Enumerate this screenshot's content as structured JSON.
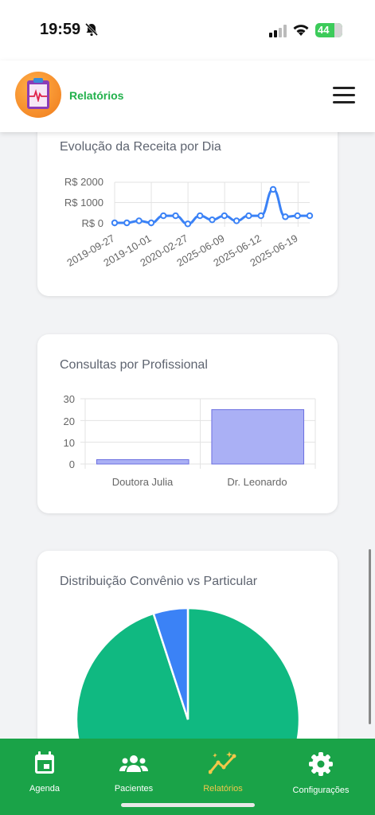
{
  "status_bar": {
    "time": "19:59",
    "battery": "44"
  },
  "header": {
    "title": "Relatórios"
  },
  "revenue_chart": {
    "title": "Evolução da Receita por Dia",
    "y_ticks": [
      "R$ 2000",
      "R$ 1000",
      "R$ 0"
    ],
    "x_ticks": [
      "2019-09-27",
      "2019-10-01",
      "2020-02-27",
      "2025-06-09",
      "2025-06-12",
      "2025-06-19"
    ]
  },
  "consultas_chart": {
    "title": "Consultas por Profissional",
    "y_ticks": [
      "30",
      "20",
      "10",
      "0"
    ]
  },
  "distribution_chart": {
    "title": "Distribuição Convênio vs Particular"
  },
  "chart_data": [
    {
      "type": "line",
      "title": "Evolução da Receita por Dia",
      "ylim": [
        0,
        2000
      ],
      "y_ticks": [
        0,
        1000,
        2000
      ],
      "x_tick_labels": [
        "2019-09-27",
        "2019-10-01",
        "2020-02-27",
        "2025-06-09",
        "2025-06-12",
        "2025-06-19"
      ],
      "values": [
        0,
        0,
        100,
        0,
        350,
        350,
        -50,
        350,
        150,
        350,
        100,
        350,
        350,
        1650,
        300,
        350,
        350
      ],
      "color": "#3b82f6"
    },
    {
      "type": "bar",
      "title": "Consultas por Profissional",
      "categories": [
        "Doutora Julia",
        "Dr. Leonardo"
      ],
      "values": [
        2,
        25
      ],
      "ylim": [
        0,
        30
      ],
      "color": "#aab0f5"
    },
    {
      "type": "pie",
      "title": "Distribuição Convênio vs Particular",
      "slices": [
        {
          "value": 95,
          "color": "#10b981"
        },
        {
          "value": 5,
          "color": "#3b82f6"
        }
      ]
    }
  ],
  "tabs": [
    {
      "label": "Agenda",
      "icon": "calendar-icon"
    },
    {
      "label": "Pacientes",
      "icon": "people-icon"
    },
    {
      "label": "Relatórios",
      "icon": "chart-trend-icon",
      "active": true
    },
    {
      "label": "Configurações",
      "icon": "gear-icon"
    }
  ]
}
